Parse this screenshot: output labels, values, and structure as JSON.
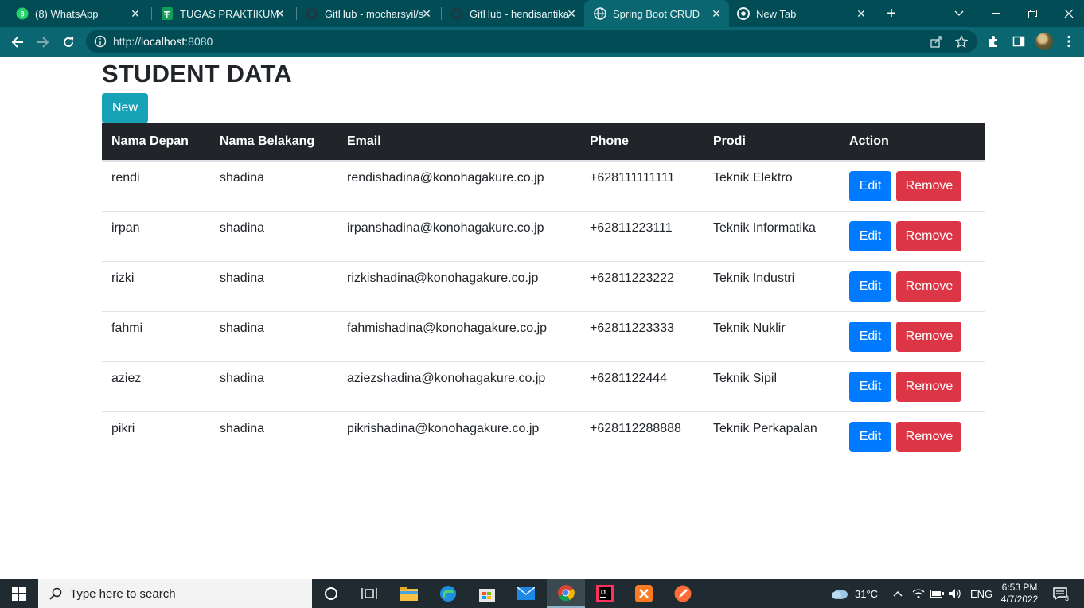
{
  "browser": {
    "tabs": [
      {
        "title": "(8) WhatsApp",
        "icon": "whatsapp-icon"
      },
      {
        "title": "TUGAS PRAKTIKUM PI",
        "icon": "sheets-icon"
      },
      {
        "title": "GitHub - mocharsyil/s",
        "icon": "github-icon"
      },
      {
        "title": "GitHub - hendisantika",
        "icon": "github-icon"
      },
      {
        "title": "Spring Boot CRUD",
        "icon": "globe-icon",
        "active": true
      },
      {
        "title": "New Tab",
        "icon": "chrome-icon"
      }
    ],
    "url_scheme": "http://",
    "url_host": "localhost",
    "url_rest": ":8080"
  },
  "page": {
    "title": "STUDENT DATA",
    "new_button": "New",
    "columns": [
      "Nama Depan",
      "Nama Belakang",
      "Email",
      "Phone",
      "Prodi",
      "Action"
    ],
    "rows": [
      {
        "nama_depan": "rendi",
        "nama_belakang": "shadina",
        "email": "rendishadina@konohagakure.co.jp",
        "phone": "+628111111111",
        "prodi": "Teknik Elektro"
      },
      {
        "nama_depan": "irpan",
        "nama_belakang": "shadina",
        "email": "irpanshadina@konohagakure.co.jp",
        "phone": "+62811223111",
        "prodi": "Teknik Informatika"
      },
      {
        "nama_depan": "rizki",
        "nama_belakang": "shadina",
        "email": "rizkishadina@konohagakure.co.jp",
        "phone": "+62811223222",
        "prodi": "Teknik Industri"
      },
      {
        "nama_depan": "fahmi",
        "nama_belakang": "shadina",
        "email": "fahmishadina@konohagakure.co.jp",
        "phone": "+62811223333",
        "prodi": "Teknik Nuklir"
      },
      {
        "nama_depan": "aziez",
        "nama_belakang": "shadina",
        "email": "aziezshadina@konohagakure.co.jp",
        "phone": "+6281122444",
        "prodi": "Teknik Sipil"
      },
      {
        "nama_depan": "pikri",
        "nama_belakang": "shadina",
        "email": "pikrishadina@konohagakure.co.jp",
        "phone": "+628112288888",
        "prodi": "Teknik Perkapalan"
      }
    ],
    "edit_label": "Edit",
    "remove_label": "Remove"
  },
  "taskbar": {
    "search_placeholder": "Type here to search",
    "weather": "31°C",
    "language": "ENG",
    "time": "6:53 PM",
    "date": "4/7/2022",
    "notifications": "3"
  },
  "colors": {
    "tab_bar": "#024c56",
    "toolbar": "#0a6670",
    "btn_new": "#17a2b8",
    "btn_edit": "#007bff",
    "btn_remove": "#dc3545",
    "table_header": "#212529"
  }
}
